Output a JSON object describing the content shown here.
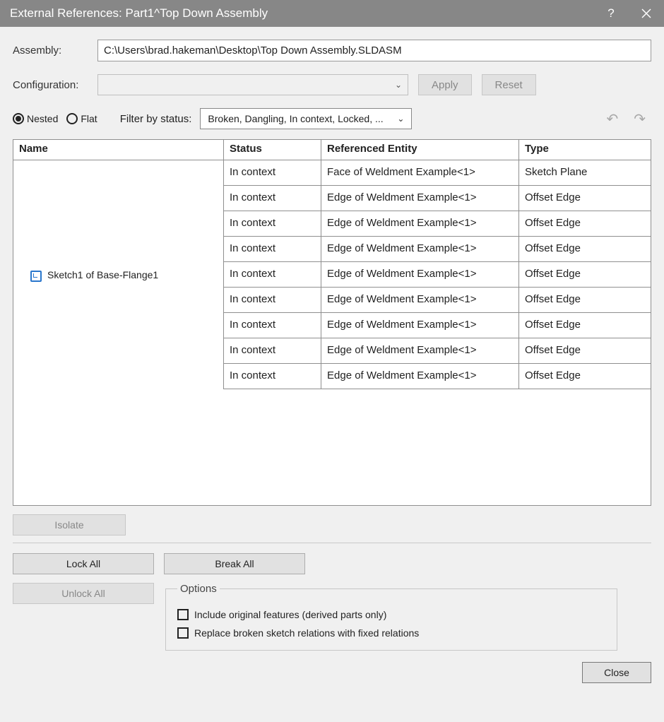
{
  "titlebar": {
    "title": "External References: Part1^Top Down Assembly"
  },
  "fields": {
    "assembly_label": "Assembly:",
    "assembly_value": "C:\\Users\\brad.hakeman\\Desktop\\Top Down Assembly.SLDASM",
    "configuration_label": "Configuration:"
  },
  "buttons": {
    "apply": "Apply",
    "reset": "Reset",
    "isolate": "Isolate",
    "lock_all": "Lock All",
    "break_all": "Break All",
    "unlock_all": "Unlock All",
    "close": "Close"
  },
  "view": {
    "nested_label": "Nested",
    "flat_label": "Flat",
    "filter_label": "Filter by status:",
    "filter_value": "Broken, Dangling, In context, Locked, ..."
  },
  "grid": {
    "headers": {
      "name": "Name",
      "status": "Status",
      "ref": "Referenced Entity",
      "type": "Type"
    },
    "name_cell": "Sketch1  of  Base-Flange1",
    "rows": [
      {
        "status": "In context",
        "ref": "Face of Weldment Example<1>",
        "type": "Sketch Plane"
      },
      {
        "status": "In context",
        "ref": "Edge of Weldment Example<1>",
        "type": "Offset Edge"
      },
      {
        "status": "In context",
        "ref": "Edge of Weldment Example<1>",
        "type": "Offset Edge"
      },
      {
        "status": "In context",
        "ref": "Edge of Weldment Example<1>",
        "type": "Offset Edge"
      },
      {
        "status": "In context",
        "ref": "Edge of Weldment Example<1>",
        "type": "Offset Edge"
      },
      {
        "status": "In context",
        "ref": "Edge of Weldment Example<1>",
        "type": "Offset Edge"
      },
      {
        "status": "In context",
        "ref": "Edge of Weldment Example<1>",
        "type": "Offset Edge"
      },
      {
        "status": "In context",
        "ref": "Edge of Weldment Example<1>",
        "type": "Offset Edge"
      },
      {
        "status": "In context",
        "ref": "Edge of Weldment Example<1>",
        "type": "Offset Edge"
      }
    ]
  },
  "options": {
    "legend": "Options",
    "include_original": "Include original features (derived parts only)",
    "replace_broken": "Replace broken sketch relations with fixed relations"
  }
}
